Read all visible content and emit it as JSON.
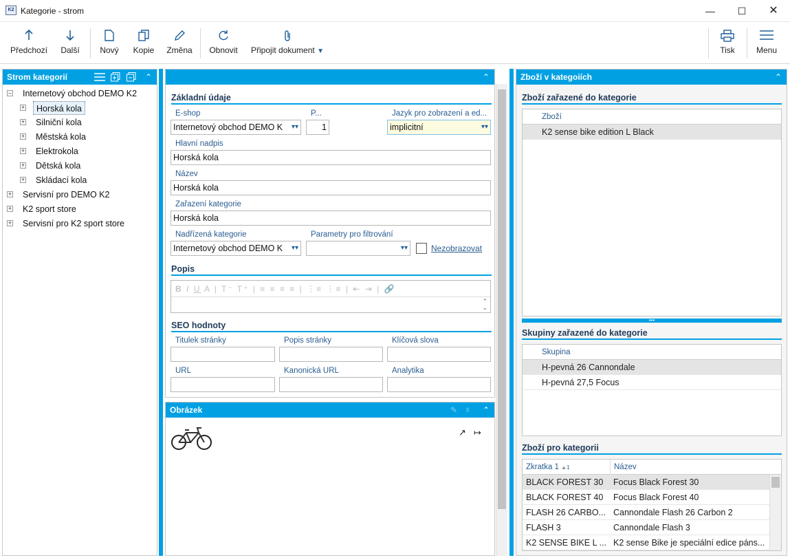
{
  "window": {
    "title": "Kategorie - strom",
    "app_icon": "K2"
  },
  "toolbar": {
    "prev": "Předchozí",
    "next": "Další",
    "new": "Nový",
    "copy": "Kopie",
    "change": "Změna",
    "refresh": "Obnovit",
    "attach": "Připojit dokument",
    "print": "Tisk",
    "menu": "Menu"
  },
  "tree_panel": {
    "title": "Strom kategorií",
    "nodes": [
      {
        "label": "Internetový obchod DEMO K2"
      },
      {
        "label": "Horská kola"
      },
      {
        "label": "Silniční kola"
      },
      {
        "label": "Městská kola"
      },
      {
        "label": "Elektrokola"
      },
      {
        "label": "Dětská kola"
      },
      {
        "label": "Skládací kola"
      },
      {
        "label": "Servisní pro DEMO K2"
      },
      {
        "label": "K2 sport store"
      },
      {
        "label": "Servisní pro K2 sport store"
      }
    ]
  },
  "form": {
    "basic_title": "Základní údaje",
    "eshop_label": "E-shop",
    "eshop_value": "Internetový obchod DEMO K",
    "p_label": "P...",
    "p_value": "1",
    "lang_label": "Jazyk pro zobrazení a ed...",
    "lang_value": "implicitní",
    "heading_label": "Hlavní nadpis",
    "heading_value": "Horská kola",
    "name_label": "Název",
    "name_value": "Horská kola",
    "category_label": "Zařazení kategorie",
    "category_value": "Horská kola",
    "parent_label": "Nadřízená kategorie",
    "parent_value": "Internetový obchod DEMO K",
    "filter_label": "Parametry pro filtrování",
    "filter_value": "",
    "hide_label": "Nezobrazovat",
    "desc_title": "Popis",
    "seo_title": "SEO hodnoty",
    "page_title_label": "Titulek stránky",
    "page_desc_label": "Popis stránky",
    "keywords_label": "Klíčová slova",
    "url_label": "URL",
    "canonical_label": "Kanonická URL",
    "analytics_label": "Analytika"
  },
  "image_panel": {
    "title": "Obrázek"
  },
  "right_panel": {
    "title": "Zboží v kategoiích",
    "goods_title": "Zboží zařazené do kategorie",
    "goods_header": "Zboží",
    "goods_rows": [
      "K2 sense bike edition L Black"
    ],
    "groups_title": "Skupiny zařazené do kategorie",
    "groups_header": "Skupina",
    "groups_rows": [
      "H-pevná 26 Cannondale",
      "H-pevná 27,5 Focus"
    ],
    "products_title": "Zboží pro kategorii",
    "products_headers": {
      "code": "Zkratka 1",
      "sort_marker": "1",
      "name": "Název"
    },
    "products_rows": [
      {
        "code": "BLACK FOREST 30",
        "name": "Focus Black Forest 30"
      },
      {
        "code": "BLACK FOREST 40",
        "name": "Focus Black Forest 40"
      },
      {
        "code": "FLASH 26 CARBO...",
        "name": "Cannondale Flash 26 Carbon 2"
      },
      {
        "code": "FLASH 3",
        "name": "Cannondale Flash 3"
      },
      {
        "code": "K2 SENSE BIKE L ...",
        "name": "K2 sense Bike je speciální edice páns..."
      }
    ]
  },
  "colors": {
    "accent": "#00a0e3",
    "label": "#2a5d91",
    "highlight_input": "#fdfbe0"
  }
}
